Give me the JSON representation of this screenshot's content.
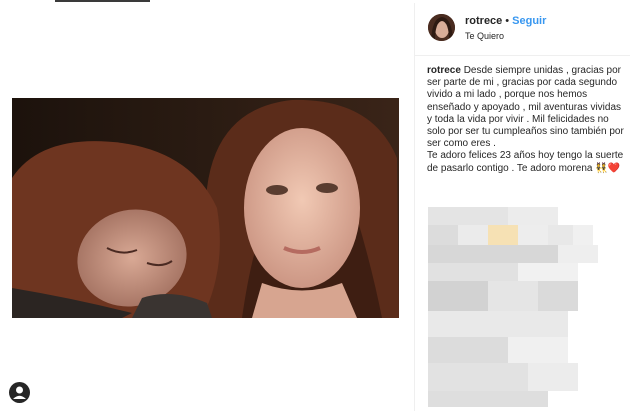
{
  "post": {
    "username": "rotrece",
    "separator": "•",
    "follow_label": "Seguir",
    "location": "Te Quiero",
    "caption_user": "rotrece",
    "caption_text": "Desde siempre unidas , gracias por ser parte de mi , gracias por cada segundo vivido a mi lado , porque nos hemos enseñado y apoyado , mil aventuras vividas y toda la vida por vivir . Mil felicidades no solo por ser tu cumpleaños sino también por ser como eres .\nTe adoro felices 23 años hoy tengo la suerte de pasarlo contigo . Te adoro morena",
    "caption_emoji": "👯❤️"
  },
  "icons": {
    "profile": "user-profile-icon"
  },
  "colors": {
    "follow": "#3897f0",
    "text": "#262626",
    "border": "#efefef"
  }
}
